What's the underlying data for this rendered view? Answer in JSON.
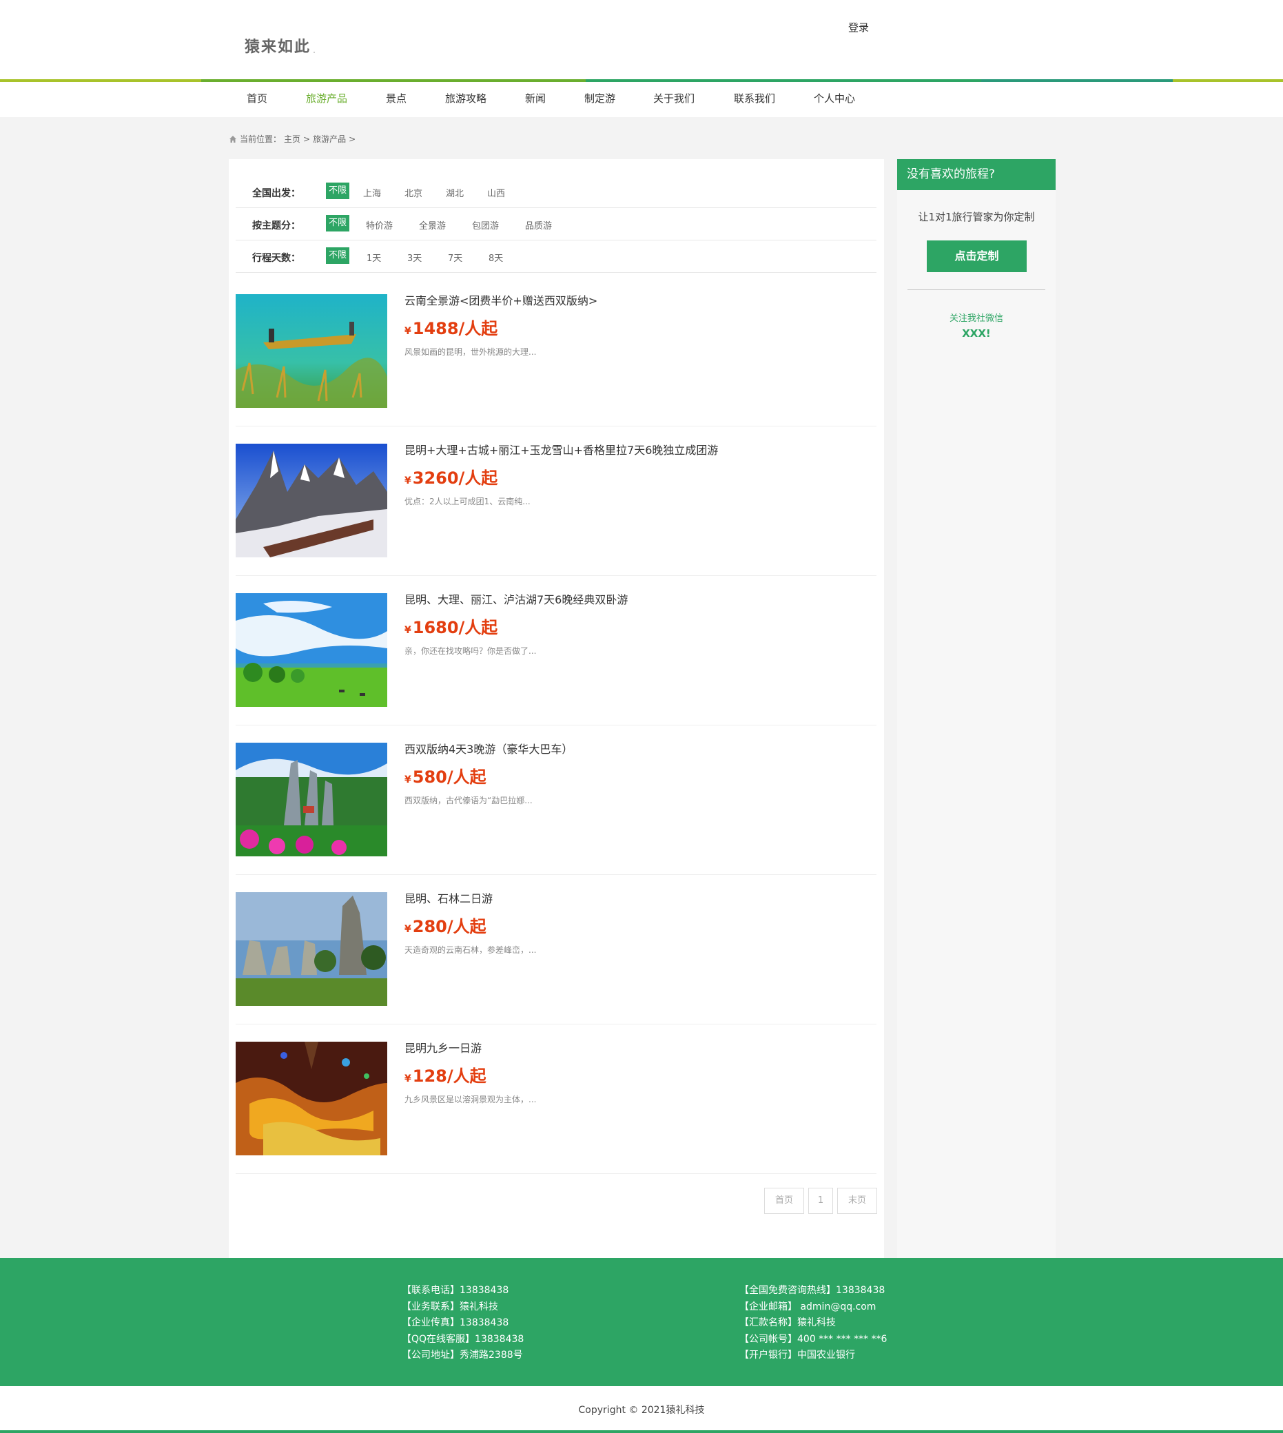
{
  "header": {
    "logo_text": "猿来如此",
    "login_label": "登录"
  },
  "colors": {
    "primary_green": "#2da564",
    "nav_active": "#6aae2e",
    "price_red": "#e33e10",
    "bar_segments": [
      "#a8c32a",
      "#6aae2e",
      "#2da564",
      "#a8c32a"
    ]
  },
  "nav": {
    "items": [
      {
        "label": "首页"
      },
      {
        "label": "旅游产品"
      },
      {
        "label": "景点"
      },
      {
        "label": "旅游攻略"
      },
      {
        "label": "新闻"
      },
      {
        "label": "制定游"
      },
      {
        "label": "关于我们"
      },
      {
        "label": "联系我们"
      },
      {
        "label": "个人中心"
      }
    ]
  },
  "breadcrumb": {
    "prefix": "当前位置：",
    "home": "主页",
    "sep1": ">",
    "current": "旅游产品",
    "sep2": ">"
  },
  "filters": [
    {
      "label": "全国出发：",
      "options": [
        "不限",
        "上海",
        "北京",
        "湖北",
        "山西"
      ]
    },
    {
      "label": "按主题分：",
      "options": [
        "不限",
        "特价游",
        "全景游",
        "包团游",
        "品质游"
      ]
    },
    {
      "label": "行程天数：",
      "options": [
        "不限",
        "1天",
        "3天",
        "7天",
        "8天"
      ]
    }
  ],
  "products": [
    {
      "title": "云南全景游<团费半价+赠送西双版纳>",
      "yen": "¥",
      "price": "1488/人起",
      "desc": "风景如画的昆明，世外桃源的大理...",
      "image": "boat-lake"
    },
    {
      "title": "昆明+大理+古城+丽江+玉龙雪山+香格里拉7天6晚独立成团游",
      "yen": "¥",
      "price": "3260/人起",
      "desc": "优点：2人以上可成团1、云南纯...",
      "image": "snow-mountain"
    },
    {
      "title": "昆明、大理、丽江、泸沽湖7天6晚经典双卧游",
      "yen": "¥",
      "price": "1680/人起",
      "desc": "亲，你还在找攻略吗？你是否做了...",
      "image": "grassland"
    },
    {
      "title": "西双版纳4天3晚游（豪华大巴车）",
      "yen": "¥",
      "price": "580/人起",
      "desc": "西双版纳，古代傣语为“勐巴拉娜...",
      "image": "stone-forest-flowers"
    },
    {
      "title": "昆明、石林二日游",
      "yen": "¥",
      "price": "280/人起",
      "desc": "天造奇观的云南石林，参差峰峦，...",
      "image": "stone-forest"
    },
    {
      "title": "昆明九乡一日游",
      "yen": "¥",
      "price": "128/人起",
      "desc": "九乡风景区是以溶洞景观为主体，...",
      "image": "cave"
    }
  ],
  "pager": {
    "first": "首页",
    "page": "1",
    "last": "末页"
  },
  "sidebar": {
    "heading": "没有喜欢的旅程?",
    "text": "让1对1旅行管家为你定制",
    "button": "点击定制",
    "wechat": "关注我社微信",
    "wechat_id": "XXX!"
  },
  "footer": {
    "left": [
      "【联系电话】13838438",
      "【业务联系】猿礼科技",
      "【企业传真】13838438",
      "【QQ在线客服】13838438",
      "【公司地址】秀浦路2388号"
    ],
    "right": [
      "【全国免费咨询热线】13838438",
      "【企业邮箱】 admin@qq.com",
      "【汇款名称】猿礼科技",
      "【公司帐号】400 *** *** *** **6",
      "【开户银行】中国农业银行"
    ],
    "copyright": "Copyright © 2021猿礼科技"
  }
}
